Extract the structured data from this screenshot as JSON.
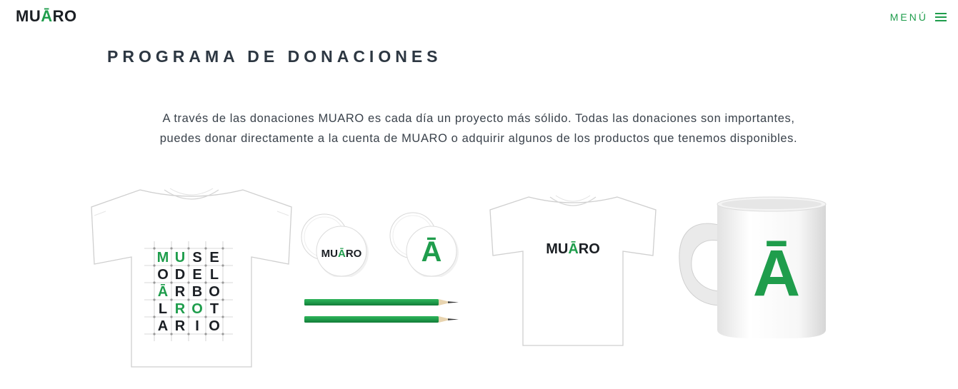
{
  "header": {
    "logo": {
      "prefix": "MU",
      "highlight": "Ā",
      "suffix": "RO"
    },
    "menu_label": "MENÚ",
    "menu_icon": "hamburger-icon"
  },
  "main": {
    "title": "PROGRAMA DE DONACIONES",
    "intro_line_1": "A través de las donaciones MUARO es cada día un proyecto más sólido. Todas las donaciones son importantes,",
    "intro_line_2": "puedes donar directamente a la cuenta de MUARO o adquirir algunos de los productos que tenemos disponibles."
  },
  "products": {
    "tshirt_grid": {
      "rows": [
        [
          {
            "t": "M",
            "g": true
          },
          {
            "t": "U",
            "g": true
          },
          {
            "t": "S",
            "g": false
          },
          {
            "t": "E",
            "g": false
          }
        ],
        [
          {
            "t": "O",
            "g": false
          },
          {
            "t": "D",
            "g": false
          },
          {
            "t": "E",
            "g": false
          },
          {
            "t": "L",
            "g": false
          }
        ],
        [
          {
            "t": "Ā",
            "g": true
          },
          {
            "t": "R",
            "g": false
          },
          {
            "t": "B",
            "g": false
          },
          {
            "t": "O",
            "g": false
          }
        ],
        [
          {
            "t": "L",
            "g": false
          },
          {
            "t": "R",
            "g": true
          },
          {
            "t": "O",
            "g": true
          },
          {
            "t": "T",
            "g": false
          }
        ],
        [
          {
            "t": "A",
            "g": false
          },
          {
            "t": "R",
            "g": false
          },
          {
            "t": "I",
            "g": false
          },
          {
            "t": "O",
            "g": false
          }
        ]
      ]
    },
    "button_1_logo": {
      "prefix": "MU",
      "highlight": "Ā",
      "suffix": "RO"
    },
    "button_2_letter": "Ā",
    "tshirt_2_logo": {
      "prefix": "MU",
      "highlight": "Ā",
      "suffix": "RO"
    },
    "mug_letter": "Ā"
  },
  "colors": {
    "accent": "#1f9d4c",
    "title": "#2d3742",
    "text": "#3a424b"
  }
}
